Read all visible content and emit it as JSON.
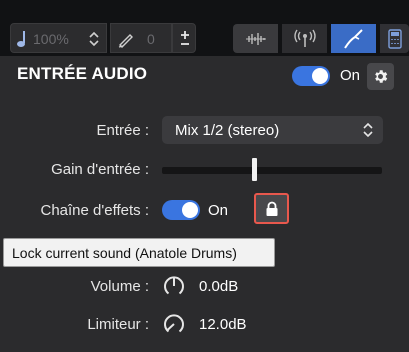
{
  "toolbar": {
    "zoom_value": "100%",
    "pen_value": "0",
    "buttons": [
      {
        "icon": "waveform-icon",
        "active": false
      },
      {
        "icon": "wireless-icon",
        "active": false
      },
      {
        "icon": "pen-tool-icon",
        "active": true
      },
      {
        "icon": "calculator-icon",
        "active": false
      }
    ]
  },
  "section": {
    "title": "ENTRÉE AUDIO",
    "on_label": "On"
  },
  "input": {
    "label": "Entrée :",
    "value": "Mix 1/2 (stereo)"
  },
  "gain": {
    "label": "Gain d'entrée :",
    "level": 0.42
  },
  "effects": {
    "label": "Chaîne d'effets :",
    "on_label": "On"
  },
  "tooltip": {
    "text": "Lock current sound (Anatole Drums)"
  },
  "volume": {
    "label": "Volume :",
    "value": "0.0dB"
  },
  "limiter": {
    "label": "Limiteur :",
    "value": "12.0dB"
  },
  "colors": {
    "accent": "#3a75e0",
    "highlight": "#e8584d",
    "panel": "#2b2b2d"
  }
}
